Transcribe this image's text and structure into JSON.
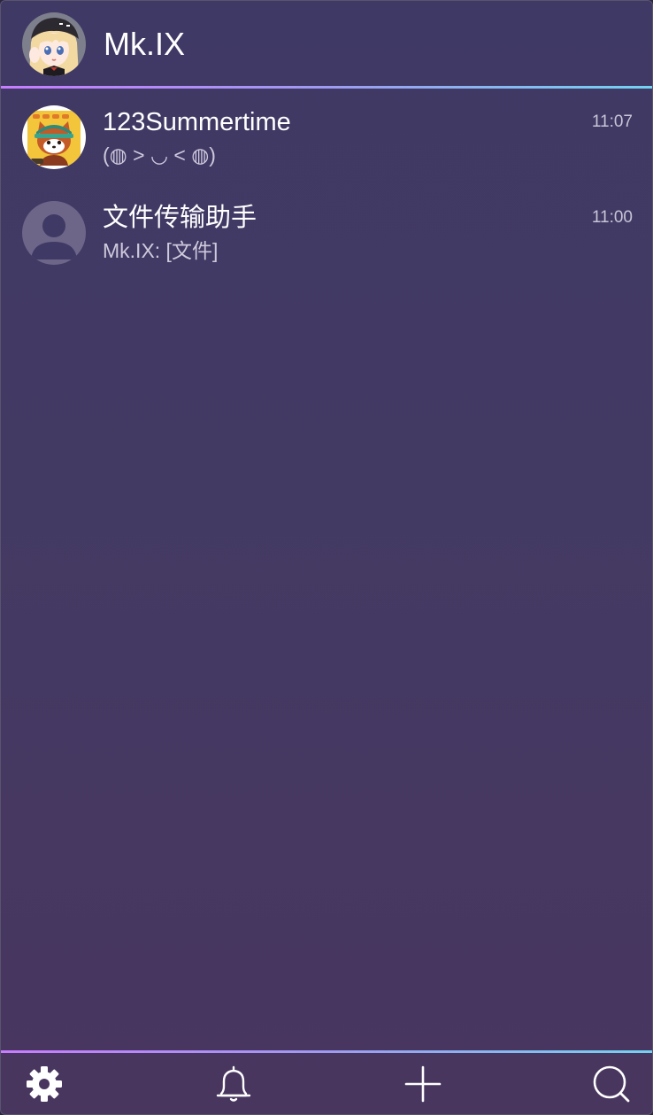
{
  "header": {
    "title": "Mk.IX",
    "avatar_icon": "anime-girl-avatar"
  },
  "chats": [
    {
      "name": "123Summertime",
      "preview": "(◍ > ◡ < ◍)",
      "time": "11:07",
      "avatar_icon": "red-panda-avatar"
    },
    {
      "name": "文件传输助手",
      "preview": "Mk.IX: [文件]",
      "time": "11:00",
      "avatar_icon": "default-user-avatar"
    }
  ],
  "footer": {
    "icons": [
      "gear-icon",
      "bell-icon",
      "plus-icon",
      "search-icon"
    ]
  },
  "colors": {
    "background_top": "#3f3965",
    "background_bottom": "#48365f",
    "accent_gradient_start": "#c77dff",
    "accent_gradient_end": "#73d2f0",
    "text_primary": "#ffffff",
    "text_secondary": "#cfc9dc"
  }
}
